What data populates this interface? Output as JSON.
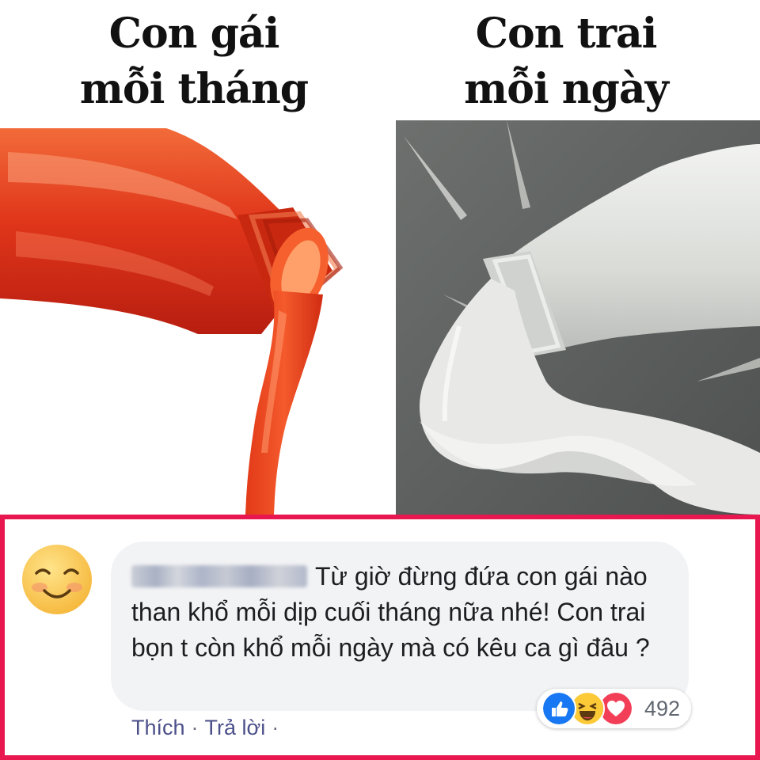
{
  "captions": {
    "left": {
      "line1": "Con gái",
      "line2": "mỗi tháng"
    },
    "right": {
      "line1": "Con trai",
      "line2": "mỗi ngày"
    }
  },
  "images": {
    "left": "ketchup bottle pouring red sauce",
    "right": "milk bottle pouring white milk"
  },
  "comment": {
    "text": "Từ giờ đừng đứa con gái nào than khổ mỗi dịp cuối tháng nữa nhé! Con trai bọn t còn khổ mỗi ngày mà có kêu ca gì đâu ?",
    "like_label": "Thích",
    "reply_label": "Trả lời",
    "separator": "·",
    "reaction_count": "492"
  },
  "colors": {
    "frame_border": "#e8174f",
    "bubble_bg": "#f2f3f5",
    "link_text": "#4b4f8a",
    "ketchup": "#e8371c",
    "milk": "#e6e8e5"
  },
  "icons": [
    "smiling-face-icon",
    "like-reaction-icon",
    "haha-reaction-icon",
    "love-reaction-icon"
  ]
}
